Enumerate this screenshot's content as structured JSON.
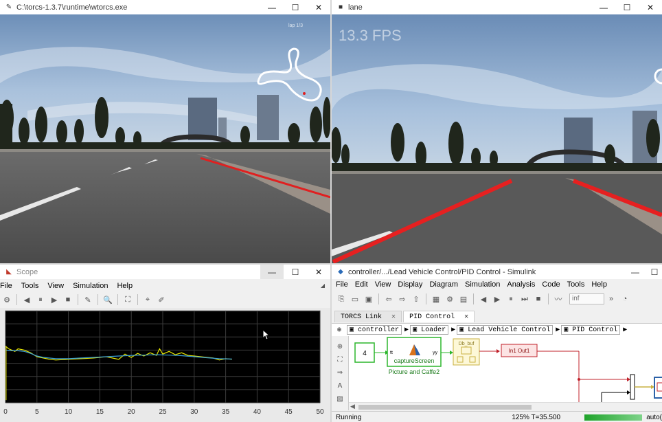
{
  "torcs": {
    "title": "C:\\torcs-1.3.7\\runtime\\wtorcs.exe",
    "map_label": "lap 1/3",
    "colors": {
      "lane_line": "#e02020"
    }
  },
  "lane": {
    "title": "lane",
    "fps": "13.3 FPS"
  },
  "scope": {
    "title": "Scope",
    "menu": [
      "File",
      "Tools",
      "View",
      "Simulation",
      "Help"
    ],
    "x_ticks": [
      "0",
      "5",
      "10",
      "15",
      "20",
      "25",
      "30",
      "35",
      "40",
      "45",
      "50"
    ],
    "series_colors": [
      "#e6e600",
      "#3aa0d8"
    ]
  },
  "chart_data": {
    "type": "line",
    "xlim": [
      0,
      50
    ],
    "ylim": [
      -3,
      4
    ],
    "y_ticks": [
      -3,
      -2,
      -1,
      0,
      1,
      2,
      3
    ],
    "grid": true,
    "series": [
      {
        "x": [
          0,
          0.5,
          1,
          1.5,
          2,
          3,
          4,
          5,
          6,
          7,
          8,
          10,
          12,
          14,
          16,
          18,
          19,
          20,
          21,
          22,
          23,
          24,
          24.5,
          25,
          26,
          27,
          28,
          29,
          30,
          32,
          33,
          34,
          35,
          36
        ],
        "values": [
          1.3,
          1.1,
          1.0,
          0.9,
          1.1,
          1.0,
          0.8,
          0.5,
          0.4,
          0.3,
          0.25,
          0.3,
          0.35,
          0.4,
          0.5,
          0.3,
          0.7,
          0.45,
          0.75,
          0.55,
          0.8,
          0.6,
          1.1,
          0.7,
          0.9,
          0.65,
          0.8,
          0.6,
          0.55,
          0.45,
          0.4,
          0.25,
          0.35,
          0.3
        ]
      },
      {
        "x": [
          0,
          1,
          2,
          3,
          4,
          5,
          6,
          8,
          10,
          12,
          14,
          16,
          18,
          20,
          22,
          24,
          26,
          28,
          30,
          32,
          34,
          36
        ],
        "values": [
          1.0,
          0.95,
          0.95,
          0.9,
          0.75,
          0.55,
          0.45,
          0.35,
          0.35,
          0.4,
          0.45,
          0.5,
          0.55,
          0.6,
          0.62,
          0.65,
          0.62,
          0.58,
          0.5,
          0.42,
          0.35,
          0.32
        ]
      }
    ]
  },
  "simulink": {
    "title": "controller/.../Lead Vehicle Control/PID Control - Simulink",
    "menu": [
      "File",
      "Edit",
      "View",
      "Display",
      "Diagram",
      "Simulation",
      "Analysis",
      "Code",
      "Tools",
      "Help"
    ],
    "stop_time": "inf",
    "tabs": [
      {
        "label": "TORCS Link"
      },
      {
        "label": "PID Control"
      }
    ],
    "breadcrumb": [
      "controller",
      "Loader",
      "Lead Vehicle Control",
      "PID Control"
    ],
    "blocks": {
      "const_value": "4",
      "capture_port_in": "tt",
      "capture_port_out": "yy",
      "capture_name": "captureScreen",
      "capture_caption": "Picture and Caffe2",
      "buffer_label": "Db_buf",
      "inout_label": "In1  Out1"
    },
    "status": {
      "state": "Running",
      "zoom_time": "125%  T=35.500",
      "solver": "auto("
    }
  }
}
